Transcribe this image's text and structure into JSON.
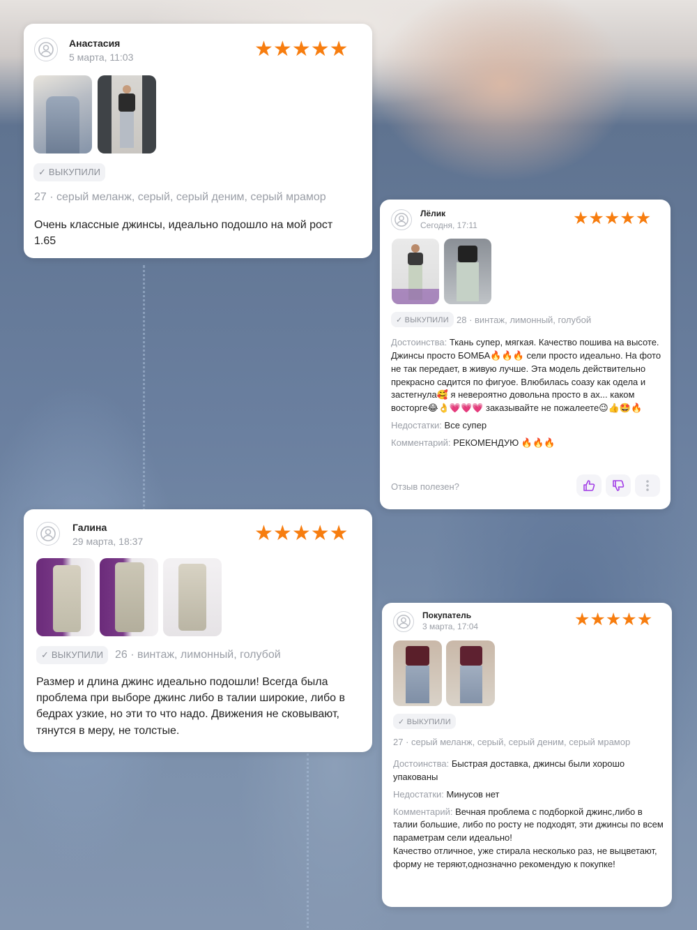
{
  "colors": {
    "star": "#f77d0f",
    "accent": "#a23ce6",
    "muted": "#9a9ea6"
  },
  "reviews": [
    {
      "name": "Анастасия",
      "date": "5 марта, 11:03",
      "rating": 5,
      "photos": 2,
      "badge": "✓ ВЫКУПИЛИ",
      "variant": "27 · серый меланж, серый, серый деним, серый мрамор",
      "text": "Очень классные джинсы, идеально подошло на мой рост 1.65"
    },
    {
      "name": "Лёлик",
      "date": "Сегодня, 17:11",
      "rating": 5,
      "photos": 2,
      "badge": "✓ ВЫКУПИЛИ",
      "variant": "28 · винтаж, лимонный, голубой",
      "pros_label": "Достоинства:",
      "pros": "Ткань супер, мягкая. Качество пошива на высоте. Джинсы просто БОМБА🔥🔥🔥 сели просто идеально. На фото не так передает, в живую лучше. Эта модель действительно прекрасно садится по фигуое. Влюбилась соазу как одела и застегнула🥰 я невероятно довольна просто в ах... каком восторге😂👌💗💗💗 заказывайте не пожалеете😉👍🤩🔥",
      "cons_label": "Недостатки:",
      "cons": "Все супер",
      "comment_label": "Комментарий:",
      "comment": "РЕКОМЕНДУЮ 🔥🔥🔥",
      "helpful": "Отзыв полезен?"
    },
    {
      "name": "Галина",
      "date": "29 марта, 18:37",
      "rating": 5,
      "photos": 3,
      "badge": "✓ ВЫКУПИЛИ",
      "variant": "26 · винтаж, лимонный, голубой",
      "text": "Размер и длина джинс идеально подошли! Всегда была проблема при выборе джинс либо в талии широкие, либо в бедрах узкие, но эти то что надо. Движения не сковывают, тянутся в меру, не толстые."
    },
    {
      "name": "Покупатель",
      "date": "3 марта, 17:04",
      "rating": 5,
      "photos": 2,
      "badge": "✓ ВЫКУПИЛИ",
      "variant": "27 · серый меланж, серый, серый деним, серый мрамор",
      "pros_label": "Достоинства:",
      "pros": "Быстрая доставка, джинсы были хорошо упакованы",
      "cons_label": "Недостатки:",
      "cons": "Минусов нет",
      "comment_label": "Комментарий:",
      "comment": "Вечная проблема с подборкой джинс,либо в талии большие, либо по росту не подходят, эти джинсы по всем параметрам сели идеально!",
      "comment2": "Качество отличное, уже стирала несколько раз, не выцветают, форму не теряют,однозначно рекомендую к покупке!"
    }
  ]
}
